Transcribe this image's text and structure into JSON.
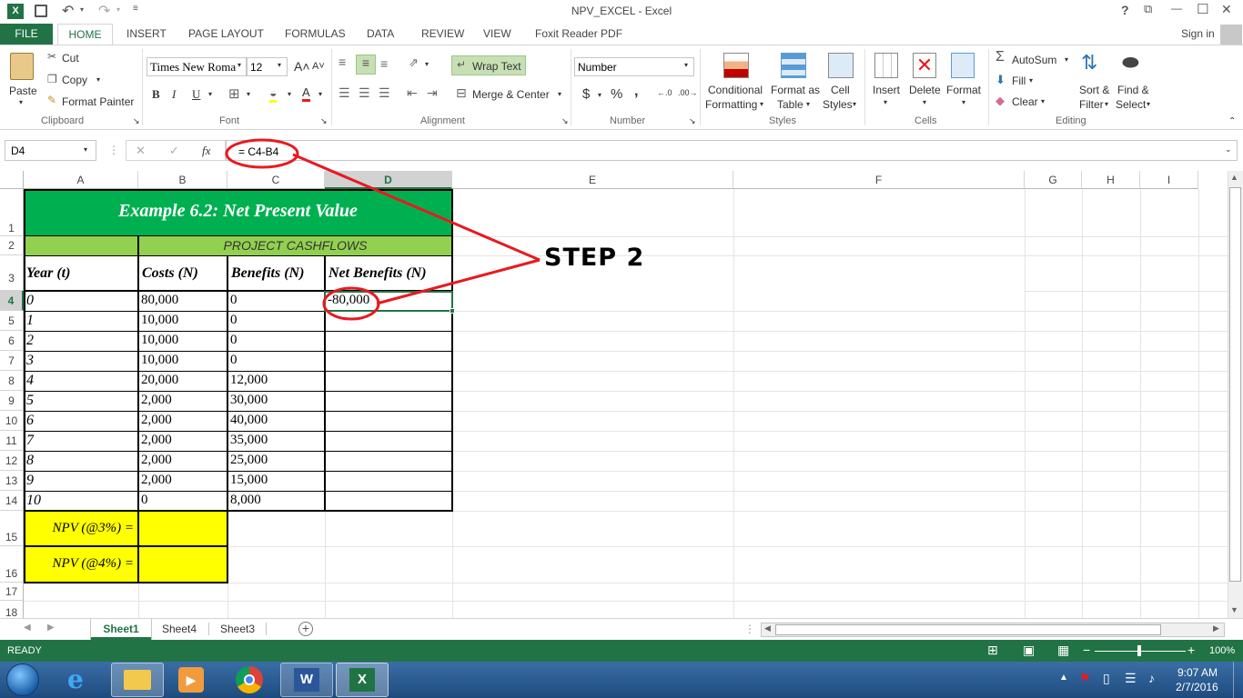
{
  "title": "NPV_EXCEL - Excel",
  "titlebar_controls": {
    "help": "?",
    "restore": "⧉",
    "minimize": "—",
    "maximize": "☐",
    "close": "✕"
  },
  "tabs": [
    "FILE",
    "HOME",
    "INSERT",
    "PAGE LAYOUT",
    "FORMULAS",
    "DATA",
    "REVIEW",
    "VIEW",
    "Foxit Reader PDF"
  ],
  "sign_in": "Sign in",
  "ribbon": {
    "clipboard": {
      "paste": "Paste",
      "cut": "Cut",
      "copy": "Copy",
      "format_painter": "Format Painter",
      "group": "Clipboard"
    },
    "font": {
      "name": "Times New Roma",
      "size": "12",
      "bold": "B",
      "italic": "I",
      "underline": "U",
      "group": "Font"
    },
    "alignment": {
      "wrap": "Wrap Text",
      "merge": "Merge & Center",
      "group": "Alignment"
    },
    "number": {
      "format": "Number",
      "currency": "$",
      "percent": "%",
      "comma": ",",
      "group": "Number"
    },
    "styles": {
      "conditional": "Conditional",
      "conditional2": "Formatting",
      "format_table": "Format as",
      "format_table2": "Table",
      "cell_styles": "Cell",
      "cell_styles2": "Styles",
      "group": "Styles"
    },
    "cells": {
      "insert": "Insert",
      "delete": "Delete",
      "format": "Format",
      "group": "Cells"
    },
    "editing": {
      "autosum": "AutoSum",
      "fill": "Fill",
      "clear": "Clear",
      "sort": "Sort &",
      "sort2": "Filter",
      "find": "Find &",
      "find2": "Select",
      "group": "Editing"
    }
  },
  "formula_bar": {
    "name_box": "D4",
    "fx": "fx",
    "formula": "= C4-B4"
  },
  "columns": [
    "A",
    "B",
    "C",
    "D",
    "E",
    "F",
    "G",
    "H",
    "I"
  ],
  "rows": [
    "1",
    "2",
    "3",
    "4",
    "5",
    "6",
    "7",
    "8",
    "9",
    "10",
    "11",
    "12",
    "13",
    "14",
    "15",
    "16",
    "17",
    "18"
  ],
  "table": {
    "title": "Example 6.2: Net Present Value",
    "subtitle": "PROJECT CASHFLOWS",
    "headers": [
      "Year (t)",
      "Costs (N)",
      "Benefits (N)",
      "Net Benefits (N)"
    ],
    "data": [
      [
        "0",
        "80,000",
        "0",
        "-80,000"
      ],
      [
        "1",
        "10,000",
        "0",
        ""
      ],
      [
        "2",
        "10,000",
        "0",
        ""
      ],
      [
        "3",
        "10,000",
        "0",
        ""
      ],
      [
        "4",
        "20,000",
        "12,000",
        ""
      ],
      [
        "5",
        "2,000",
        "30,000",
        ""
      ],
      [
        "6",
        "2,000",
        "40,000",
        ""
      ],
      [
        "7",
        "2,000",
        "35,000",
        ""
      ],
      [
        "8",
        "2,000",
        "25,000",
        ""
      ],
      [
        "9",
        "2,000",
        "15,000",
        ""
      ],
      [
        "10",
        "0",
        "8,000",
        ""
      ]
    ],
    "npv3": "NPV (@3%) =",
    "npv4": "NPV (@4%) ="
  },
  "annotation": "STEP 2",
  "sheets": [
    "Sheet1",
    "Sheet4",
    "Sheet3"
  ],
  "status": {
    "ready": "READY",
    "zoom": "100%"
  },
  "taskbar": {
    "time": "9:07 AM",
    "date": "2/7/2016"
  },
  "colors": {
    "excel_green": "#217346",
    "header_green": "#00b050",
    "sub_green": "#92d050",
    "yellow": "#ffff00",
    "annotation_red": "#e8191f"
  }
}
